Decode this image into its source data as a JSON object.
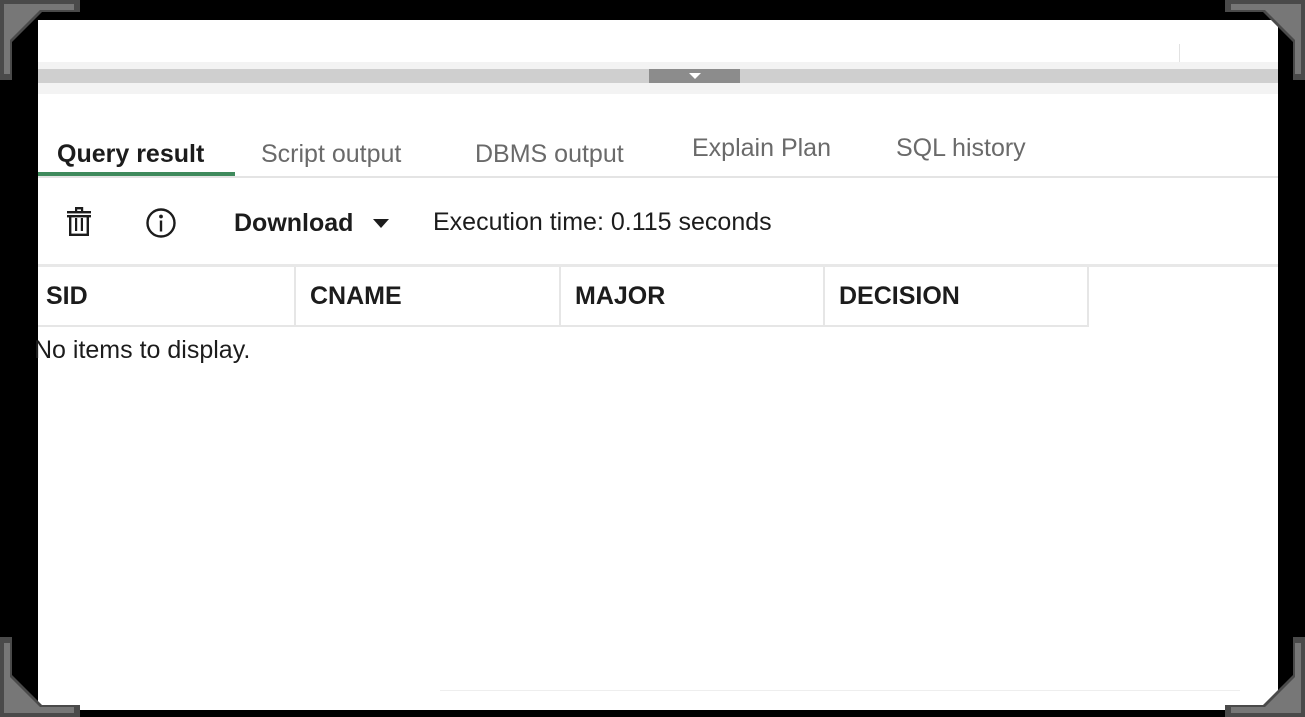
{
  "tabs": [
    {
      "label": "Query result",
      "active": true
    },
    {
      "label": "Script output",
      "active": false
    },
    {
      "label": "DBMS output",
      "active": false
    },
    {
      "label": "Explain Plan",
      "active": false
    },
    {
      "label": "SQL history",
      "active": false
    }
  ],
  "toolbar": {
    "delete_icon": "trash-icon",
    "info_icon": "info-icon",
    "download_label": "Download",
    "execution_time": "Execution time: 0.115 seconds"
  },
  "grid": {
    "columns": [
      "SID",
      "CNAME",
      "MAJOR",
      "DECISION"
    ],
    "empty_message": "No items to display."
  },
  "colors": {
    "active_tab_underline": "#3f8a5c",
    "splitter_handle": "#8c8c8c",
    "frame": "#000000"
  }
}
